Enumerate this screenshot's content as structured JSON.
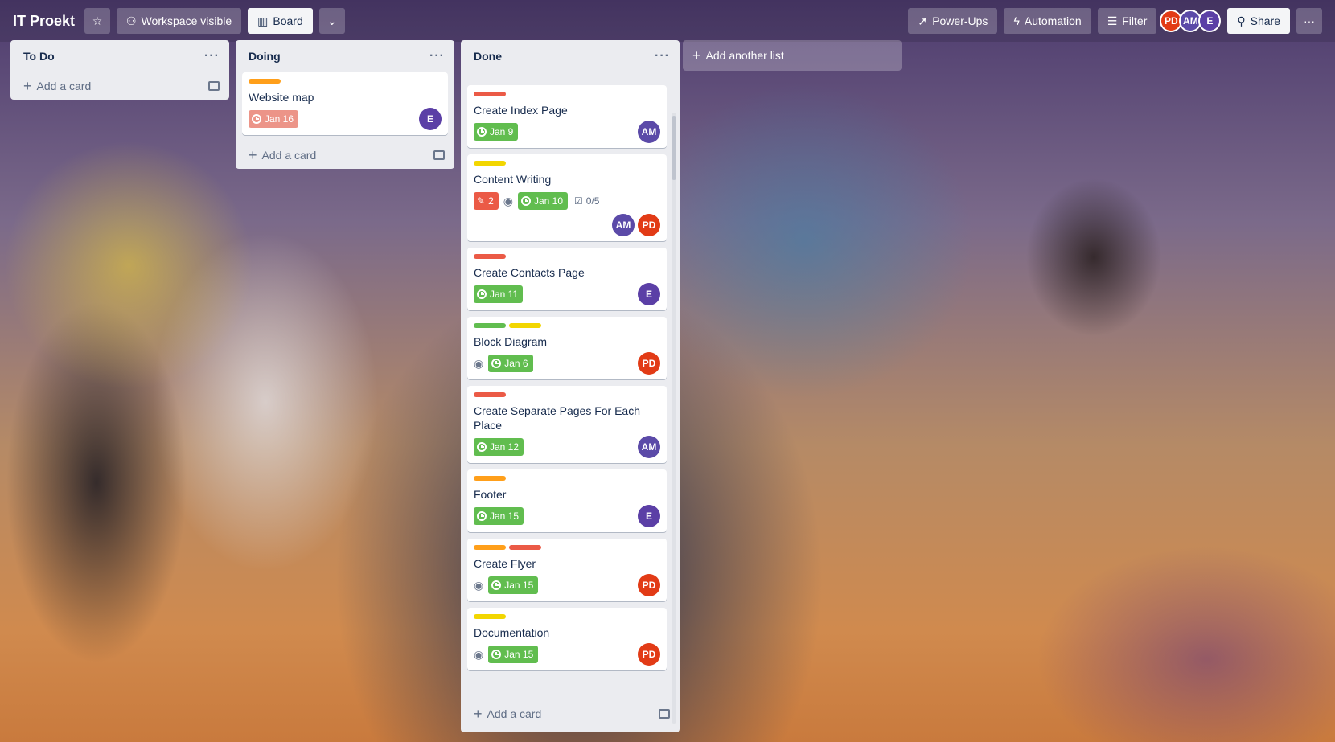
{
  "header": {
    "title": "IT Proekt",
    "workspace_label": "Workspace visible",
    "view_label": "Board",
    "powerups_label": "Power-Ups",
    "automation_label": "Automation",
    "filter_label": "Filter",
    "share_label": "Share",
    "members": [
      "PD",
      "AM",
      "E"
    ]
  },
  "lists": [
    {
      "title": "To Do",
      "add_card": "Add a card"
    },
    {
      "title": "Doing",
      "add_card": "Add a card",
      "cards": [
        {
          "title": "Website map",
          "due": "Jan 16",
          "members": [
            "E"
          ]
        }
      ]
    },
    {
      "title": "Done",
      "add_card": "Add a card",
      "cards": [
        {
          "title": "Create Index Page",
          "due": "Jan 9",
          "members": [
            "AM"
          ]
        },
        {
          "title": "Content Writing",
          "comments": "2",
          "due": "Jan 10",
          "checklist": "0/5",
          "members": [
            "AM",
            "PD"
          ]
        },
        {
          "title": "Create Contacts Page",
          "due": "Jan 11",
          "members": [
            "E"
          ]
        },
        {
          "title": "Block Diagram",
          "due": "Jan 6",
          "members": [
            "PD"
          ]
        },
        {
          "title": "Create Separate Pages For Each Place",
          "due": "Jan 12",
          "members": [
            "AM"
          ]
        },
        {
          "title": "Footer",
          "due": "Jan 15",
          "members": [
            "E"
          ]
        },
        {
          "title": "Create Flyer",
          "due": "Jan 15",
          "members": [
            "PD"
          ]
        },
        {
          "title": "Documentation",
          "due": "Jan 15",
          "members": [
            "PD"
          ]
        }
      ]
    }
  ],
  "add_list_label": "Add another list",
  "colors": {
    "green": "#61bd4f",
    "red": "#eb5a46",
    "orange": "#ff9f1a",
    "yellow": "#f2d600",
    "label_green": "#61bd4f"
  }
}
